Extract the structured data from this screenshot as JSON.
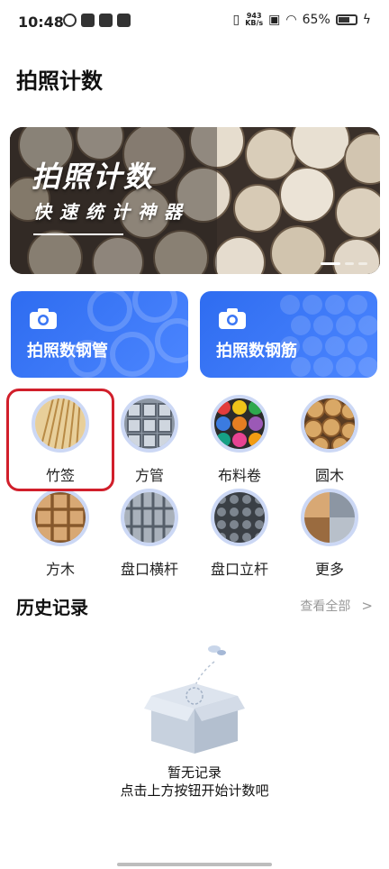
{
  "status_bar": {
    "time": "10:48",
    "net_speed_value": "943",
    "net_speed_unit": "KB/s",
    "battery": "65%"
  },
  "page": {
    "title": "拍照计数"
  },
  "banner": {
    "title": "拍照计数",
    "subtitle": "快速统计神器"
  },
  "quick_actions": [
    {
      "label": "拍照数钢管",
      "icon": "camera-icon"
    },
    {
      "label": "拍照数钢筋",
      "icon": "camera-icon"
    }
  ],
  "categories": [
    {
      "label": "竹签",
      "highlighted": true
    },
    {
      "label": "方管"
    },
    {
      "label": "布料卷"
    },
    {
      "label": "圆木"
    },
    {
      "label": "方木"
    },
    {
      "label": "盘口横杆"
    },
    {
      "label": "盘口立杆"
    },
    {
      "label": "更多"
    }
  ],
  "history": {
    "title": "历史记录",
    "view_all": "查看全部",
    "empty_line1": "暂无记录",
    "empty_line2": "点击上方按钮开始计数吧"
  },
  "colors": {
    "accent_blue": "#3a76f5",
    "highlight_red": "#d11f2b",
    "muted_text": "#999999"
  }
}
